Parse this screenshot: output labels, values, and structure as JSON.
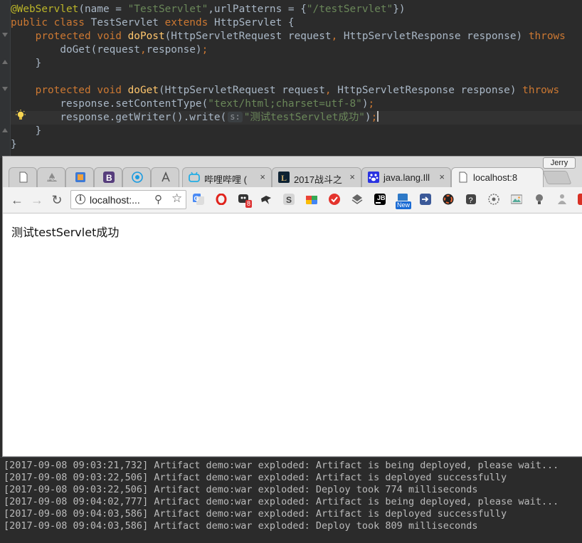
{
  "editor": {
    "annotation": "@WebServlet",
    "ann_open": "(name = ",
    "ann_name": "\"TestServlet\"",
    "ann_mid": ",urlPatterns = {",
    "ann_url": "\"/testServlet\"",
    "ann_close": "})",
    "kw_public": "public",
    "kw_class": "class",
    "class_name": "TestServlet",
    "kw_extends": "extends",
    "super_class": "HttpServlet {",
    "kw_protected": "protected",
    "kw_void": "void",
    "method_post": "doPost",
    "method_get": "doGet",
    "params_1": "(HttpServletRequest request",
    "comma": ",",
    "params_2": " HttpServletResponse response) ",
    "kw_throws": "throws",
    "call_doget_a": "doGet(request",
    "call_doget_b": "response)",
    "semicolon": ";",
    "close_brace": "}",
    "set_ct_a": "response.setContentType(",
    "set_ct_str": "\"text/html;charset=utf-8\"",
    "set_ct_b": ")",
    "write_a": "response.getWriter().write(",
    "hint_label": "s:",
    "write_str": "\"测试testServlet成功\"",
    "write_b": ")"
  },
  "browser": {
    "profile_name": "Jerry",
    "tabs": [
      {
        "title": "",
        "icon": "page-icon"
      },
      {
        "title": "",
        "icon": "phpmyadmin-icon"
      },
      {
        "title": "",
        "icon": "gradient-app-icon"
      },
      {
        "title": "",
        "icon": "bootstrap-icon"
      },
      {
        "title": "",
        "icon": "globe-target-icon"
      },
      {
        "title": "",
        "icon": "angular-icon"
      },
      {
        "title": "哔哩哔哩 (",
        "icon": "bilibili-icon"
      },
      {
        "title": "2017战斗之",
        "icon": "league-icon"
      },
      {
        "title": "java.lang.Ill",
        "icon": "baidu-paw-icon"
      },
      {
        "title": "localhost:8",
        "icon": "page-icon"
      }
    ],
    "close_glyph": "×",
    "url": "localhost:...",
    "info_glyph": "i",
    "page_text": "测试testServlet成功",
    "extension_badges": {
      "mail": "8",
      "new": "New",
      "jb": "JB"
    }
  },
  "console": {
    "lines": [
      "[2017-09-08 09:03:21,732] Artifact demo:war exploded: Artifact is being deployed, please wait...",
      "[2017-09-08 09:03:22,506] Artifact demo:war exploded: Artifact is deployed successfully",
      "[2017-09-08 09:03:22,506] Artifact demo:war exploded: Deploy took 774 milliseconds",
      "[2017-09-08 09:04:02,777] Artifact demo:war exploded: Artifact is being deployed, please wait...",
      "[2017-09-08 09:04:03,586] Artifact demo:war exploded: Artifact is deployed successfully",
      "[2017-09-08 09:04:03,586] Artifact demo:war exploded: Deploy took 809 milliseconds"
    ]
  },
  "colors": {
    "keyword": "#cc7832",
    "string": "#6a8759",
    "annotation": "#bbb529",
    "method": "#ffc66d",
    "text": "#a9b7c6",
    "editor_bg": "#2b2b2b"
  }
}
